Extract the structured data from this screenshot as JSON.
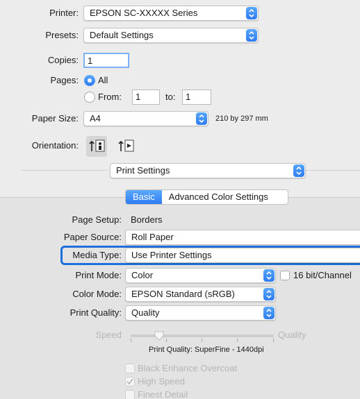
{
  "top": {
    "printer": {
      "label": "Printer:",
      "value": "EPSON SC-XXXXX Series"
    },
    "presets": {
      "label": "Presets:",
      "value": "Default Settings"
    },
    "copies": {
      "label": "Copies:",
      "value": "1"
    },
    "pages": {
      "label": "Pages:",
      "all_label": "All",
      "from_label": "From:",
      "from_value": "1",
      "to_label": "to:",
      "to_value": "1"
    },
    "paper_size": {
      "label": "Paper Size:",
      "value": "A4",
      "dimensions": "210 by 297 mm"
    },
    "orientation": {
      "label": "Orientation:",
      "options": [
        "portrait-icon",
        "landscape-icon"
      ],
      "selected": 0
    }
  },
  "section_popup": "Print Settings",
  "tabs": {
    "basic": "Basic",
    "advanced": "Advanced Color Settings",
    "active": "Basic"
  },
  "settings": {
    "page_setup": {
      "label": "Page Setup:",
      "value": "Borders"
    },
    "paper_source": {
      "label": "Paper Source:",
      "value": "Roll Paper"
    },
    "media_type": {
      "label": "Media Type:",
      "value": "Use Printer Settings"
    },
    "print_mode": {
      "label": "Print Mode:",
      "value": "Color",
      "checkbox_label": "16 bit/Channel"
    },
    "color_mode": {
      "label": "Color Mode:",
      "value": "EPSON Standard (sRGB)"
    },
    "print_quality": {
      "label": "Print Quality:",
      "value": "Quality"
    },
    "slider": {
      "left_label": "Speed",
      "right_label": "Quality",
      "caption": "Print Quality: SuperFine - 1440dpi",
      "level": 0.2
    },
    "options": [
      {
        "label": "Black Enhance Overcoat",
        "checked": false
      },
      {
        "label": "High Speed",
        "checked": true
      },
      {
        "label": "Finest Detail",
        "checked": false
      }
    ]
  },
  "colors": {
    "accent": "#2f7cf3",
    "focus_ring": "#1e6fdc"
  }
}
